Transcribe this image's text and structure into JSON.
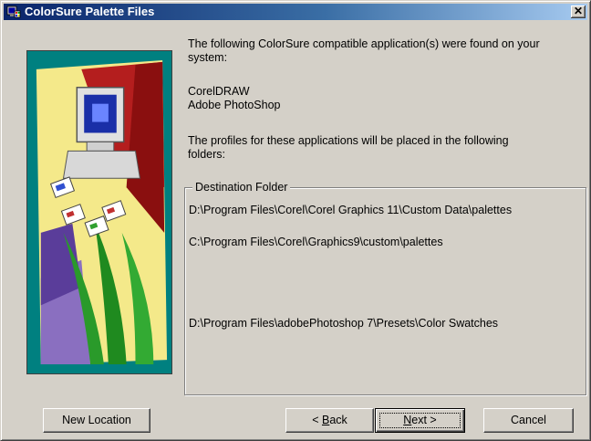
{
  "window": {
    "title": "ColorSure Palette Files",
    "close_glyph": "✕"
  },
  "intro": {
    "line1": "The following ColorSure compatible application(s) were found on your",
    "line2": "system:"
  },
  "applications": [
    "CorelDRAW",
    "Adobe PhotoShop"
  ],
  "profiles_text": {
    "line1": "The profiles for these applications will be placed in the following",
    "line2": "folders:"
  },
  "destination": {
    "legend": "Destination Folder",
    "folders": [
      "D:\\Program Files\\Corel\\Corel Graphics 11\\Custom Data\\palettes",
      "C:\\Program Files\\Corel\\Graphics9\\custom\\palettes",
      "D:\\Program Files\\adobePhotoshop 7\\Presets\\Color Swatches"
    ]
  },
  "buttons": {
    "new_location": "New Location",
    "back_prefix": "< ",
    "back_key": "B",
    "back_rest": "ack",
    "next_key": "N",
    "next_rest": "ext >",
    "cancel": "Cancel"
  },
  "icons": {
    "app_icon": "palette-app-icon",
    "illustration": "computer-wizard-illustration"
  },
  "colors": {
    "title_start": "#0a246a",
    "title_end": "#a6caf0",
    "art_background": "#008080"
  }
}
